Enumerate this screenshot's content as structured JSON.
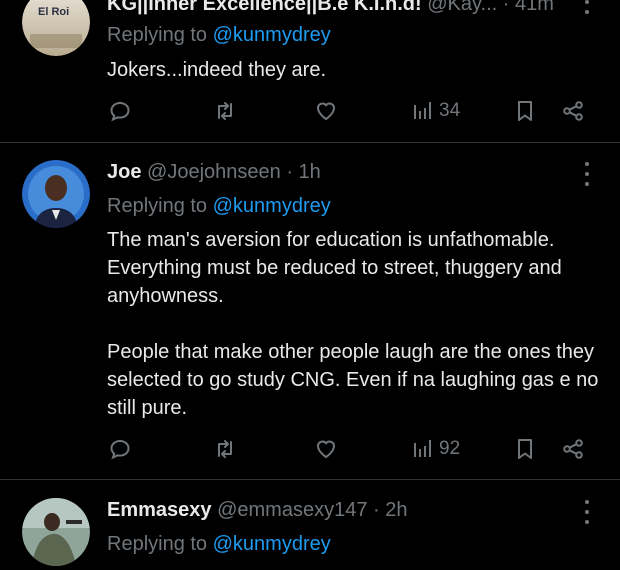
{
  "tweets": [
    {
      "name": "KG||Inner Excellence||B.e K.I.n.d!",
      "handle": "@Kay...",
      "time": "41m",
      "avatar_icon": "el-roi-avatar",
      "avatar_text": "El Roi",
      "replying_label": "Replying to",
      "replying_to": "@kunmydrey",
      "text": "Jokers...indeed they are.",
      "views": "34"
    },
    {
      "name": "Joe",
      "handle": "@Joejohnseen",
      "time": "1h",
      "avatar_icon": "user-avatar",
      "replying_label": "Replying to",
      "replying_to": "@kunmydrey",
      "text": "The man's aversion for education is unfathomable. Everything must be reduced to street, thuggery and anyhowness.\n\nPeople that make other people laugh are the ones they selected to go study CNG. Even if na laughing gas e no still pure.",
      "views": "92"
    },
    {
      "name": "Emmasexy",
      "handle": "@emmasexy147",
      "time": "2h",
      "avatar_icon": "user-avatar",
      "replying_label": "Replying to",
      "replying_to": "@kunmydrey"
    }
  ],
  "icons": {
    "reply": "reply-icon",
    "retweet": "retweet-icon",
    "like": "heart-icon",
    "views": "views-icon",
    "bookmark": "bookmark-icon",
    "share": "share-icon",
    "more": "more-icon"
  },
  "colors": {
    "background": "#000000",
    "text": "#e7e9ea",
    "muted": "#71767b",
    "mention": "#1d9bf0",
    "divider": "#2f3336"
  }
}
